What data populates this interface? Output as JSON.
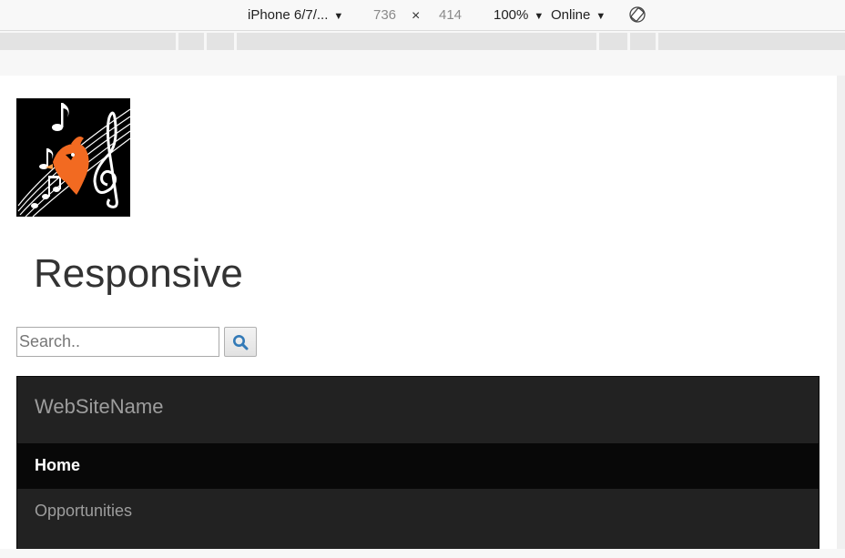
{
  "device_toolbar": {
    "device": "iPhone 6/7/...",
    "width": "736",
    "times": "×",
    "height": "414",
    "zoom": "100%",
    "throttling": "Online"
  },
  "page": {
    "title": "Responsive",
    "search": {
      "placeholder": "Search.."
    },
    "navbar": {
      "brand": "WebSiteName",
      "items": [
        {
          "label": "Home",
          "active": true
        },
        {
          "label": "Opportunities",
          "active": false
        }
      ]
    }
  },
  "colors": {
    "navbar_bg": "#222222",
    "navbar_active_bg": "#080808",
    "navbar_text": "#9d9d9d",
    "search_icon": "#337ab7",
    "logo_accent": "#f26a21"
  },
  "icons": {
    "rotate": "rotate-device-icon",
    "search": "search-icon",
    "logo": "music-notes-bird-logo"
  }
}
